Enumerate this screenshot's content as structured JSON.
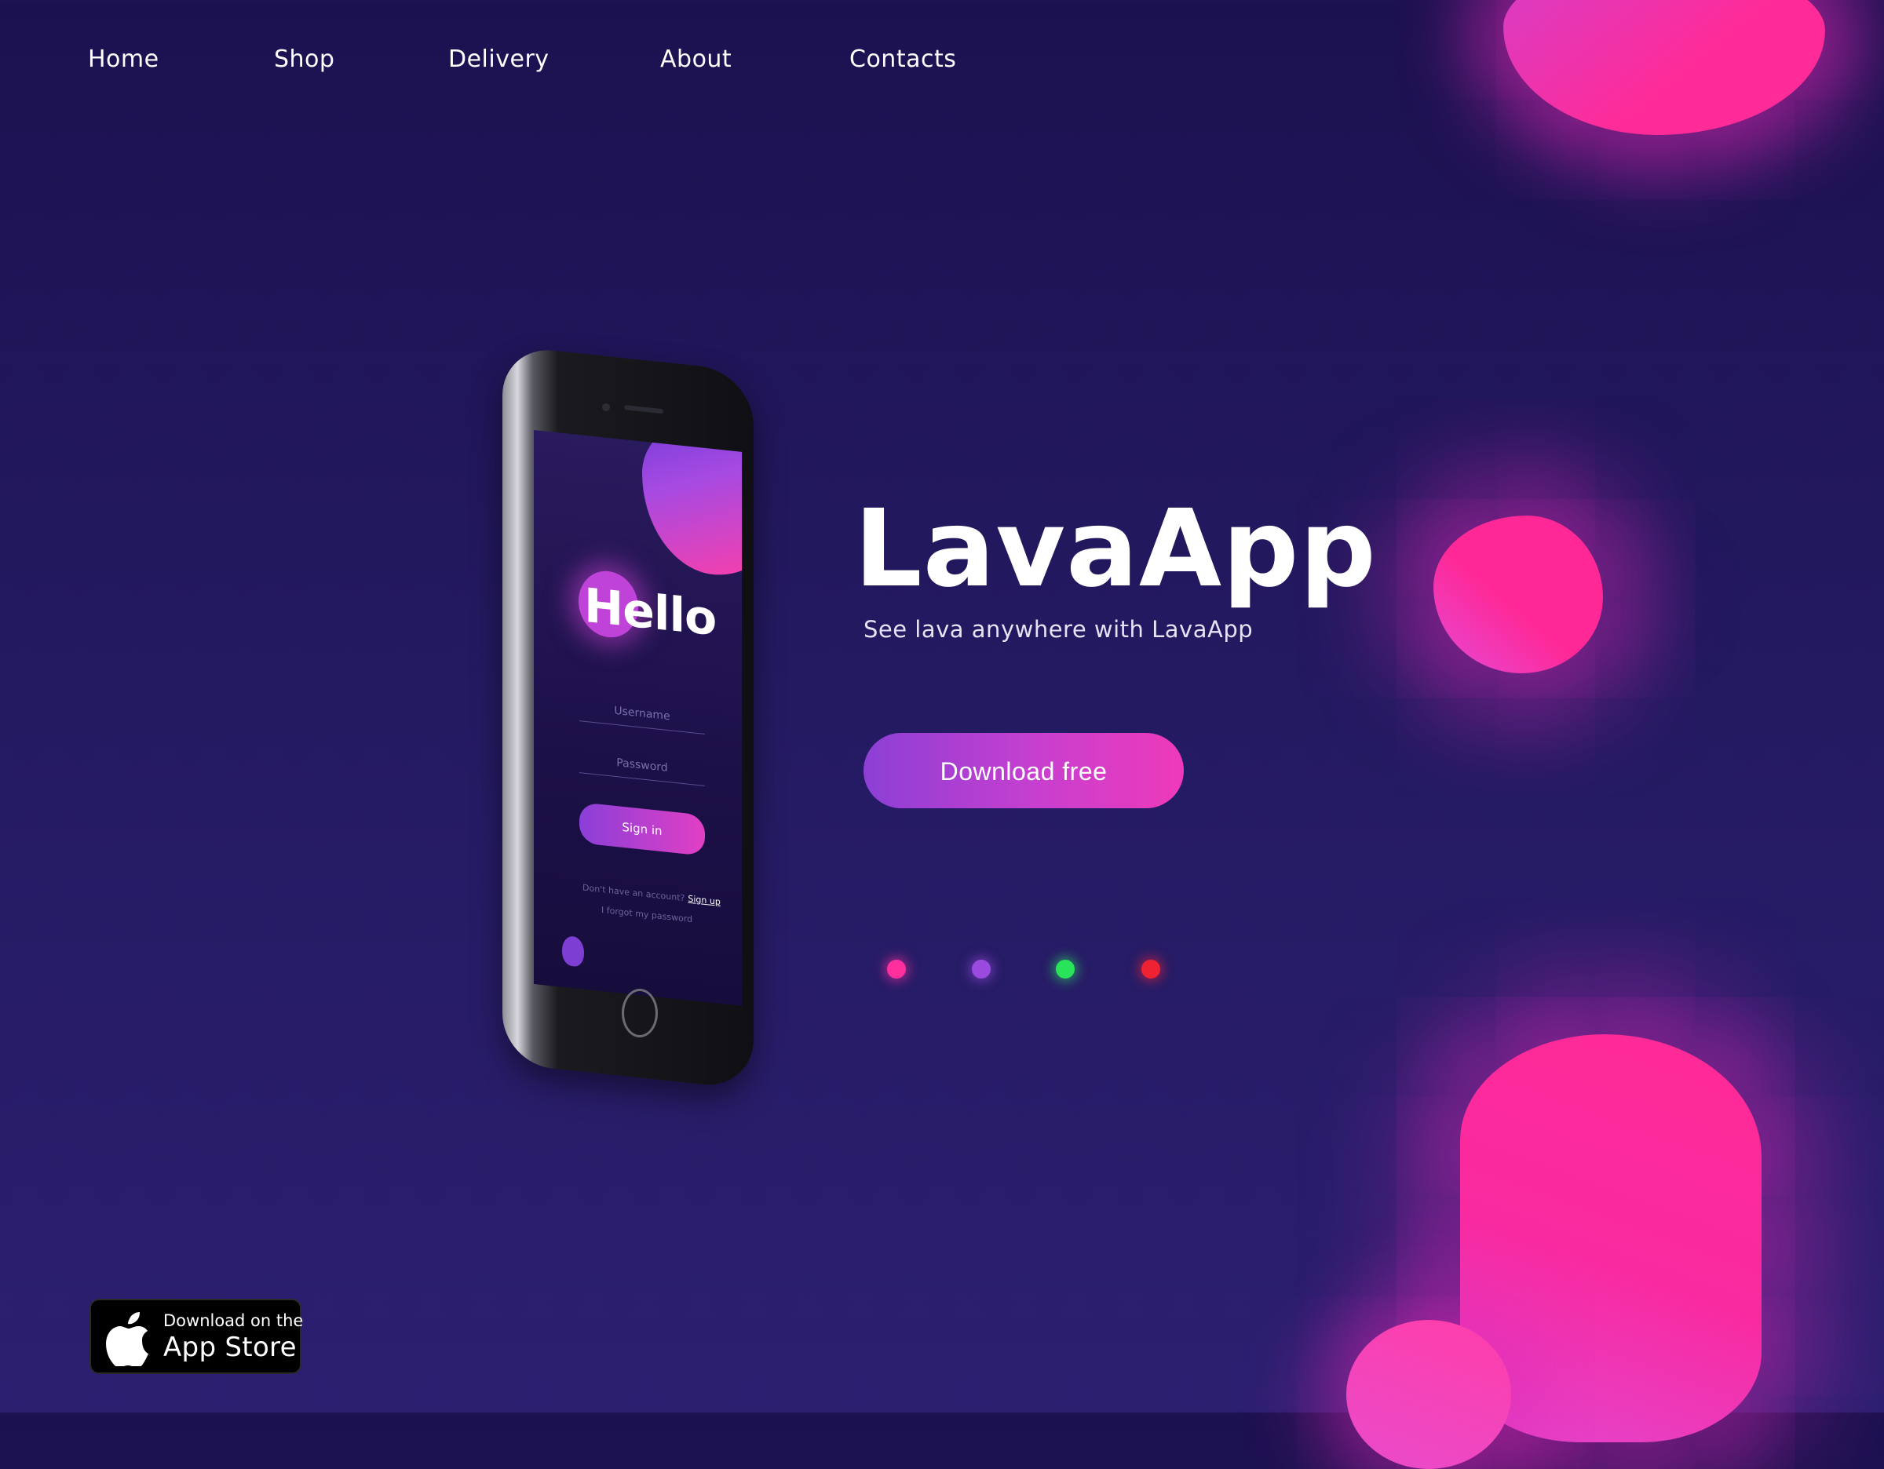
{
  "nav": {
    "items": [
      {
        "label": "Home"
      },
      {
        "label": "Shop"
      },
      {
        "label": "Delivery"
      },
      {
        "label": "About"
      },
      {
        "label": "Contacts"
      }
    ]
  },
  "hero": {
    "title": "LavaApp",
    "subtitle": "See lava anywhere with LavaApp",
    "cta_label": "Download free"
  },
  "phone_screen": {
    "greeting": "Hello",
    "username_placeholder": "Username",
    "password_placeholder": "Password",
    "signin_label": "Sign in",
    "no_account_text": "Don't have an account?",
    "signup_link": "Sign up",
    "forgot_link": "I forgot my password"
  },
  "carousel_dots": {
    "colors": [
      "#ff2f9e",
      "#9b4adf",
      "#29e35a",
      "#ef2233"
    ]
  },
  "app_store_badge": {
    "line1": "Download on the",
    "line2": "App Store",
    "icon": "apple-icon"
  },
  "colors": {
    "background_top": "#1c1150",
    "background_bottom": "#2c1f70",
    "accent_pink": "#ff2b98",
    "accent_purple": "#8c3fd5"
  }
}
